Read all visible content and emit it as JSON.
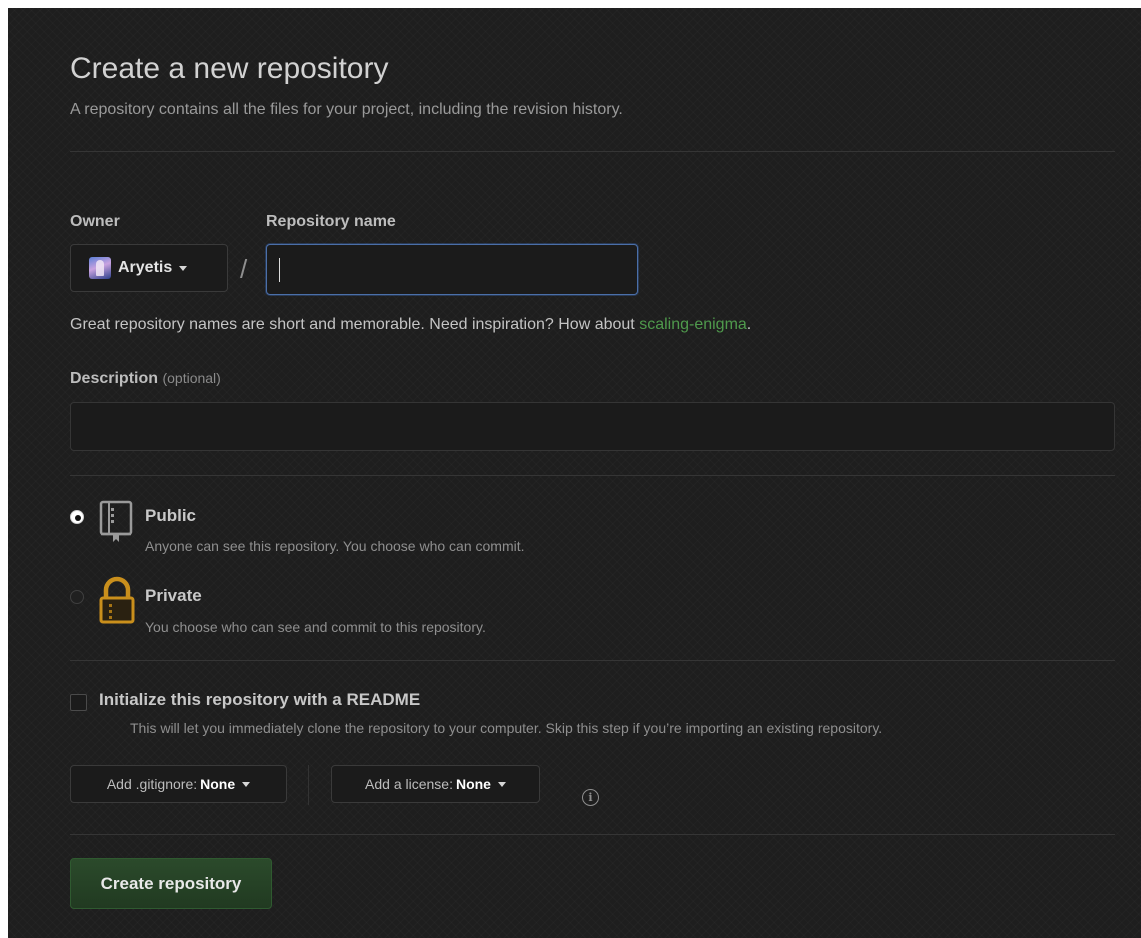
{
  "header": {
    "title": "Create a new repository",
    "subtitle": "A repository contains all the files for your project, including the revision history."
  },
  "owner": {
    "label": "Owner",
    "selected": "Aryetis"
  },
  "repo_name": {
    "label": "Repository name",
    "value": "",
    "separator": "/"
  },
  "hint": {
    "prefix": "Great repository names are short and memorable. Need inspiration? How about ",
    "suggestion": "scaling-enigma",
    "suffix": "."
  },
  "description": {
    "label": "Description",
    "optional": "(optional)",
    "value": ""
  },
  "visibility": {
    "selected": "public",
    "public": {
      "title": "Public",
      "description": "Anyone can see this repository. You choose who can commit."
    },
    "private": {
      "title": "Private",
      "description": "You choose who can see and commit to this repository."
    }
  },
  "readme": {
    "checked": false,
    "title": "Initialize this repository with a README",
    "description": "This will let you immediately clone the repository to your computer. Skip this step if you’re importing an existing repository."
  },
  "gitignore": {
    "prefix": "Add .gitignore:",
    "value": "None"
  },
  "license": {
    "prefix": "Add a license:",
    "value": "None"
  },
  "info_icon_glyph": "i",
  "submit": {
    "label": "Create repository"
  },
  "colors": {
    "background": "#1e1e1e",
    "link_green": "#4f9a4c",
    "focus_blue": "#4b6fa8",
    "submit_green": "#2b4a2b",
    "private_icon": "#c98f1c"
  },
  "icons": {
    "public": "repo-book-icon",
    "private": "lock-icon",
    "dropdown": "caret-down-icon",
    "info": "info-icon"
  }
}
